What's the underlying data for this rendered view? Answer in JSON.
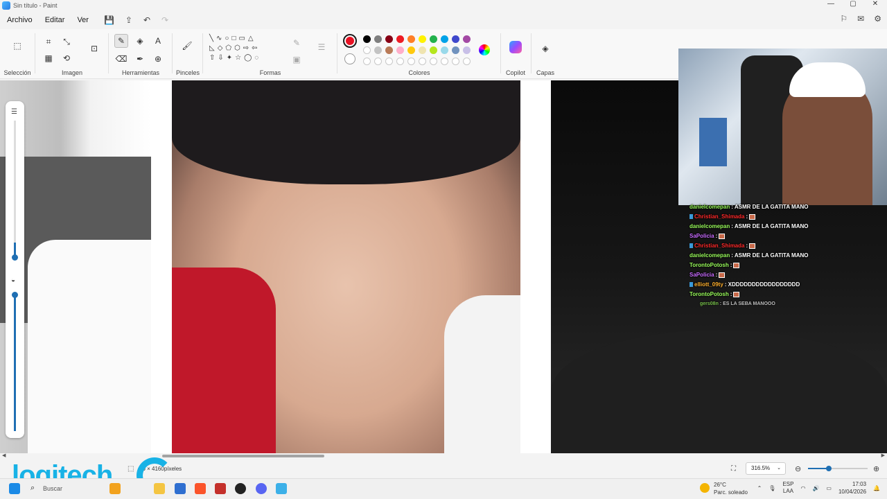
{
  "window": {
    "title": "Sin título - Paint"
  },
  "menu": {
    "archivo": "Archivo",
    "editar": "Editar",
    "ver": "Ver"
  },
  "ribbon": {
    "groups": {
      "seleccion": "Selección",
      "imagen": "Imagen",
      "herramientas": "Herramientas",
      "pinceles": "Pinceles",
      "formas": "Formas",
      "colores": "Colores",
      "copilot": "Copilot",
      "capas": "Capas"
    }
  },
  "colors": {
    "primary": "#e81123",
    "palette_row1": [
      "#000000",
      "#7f7f7f",
      "#880015",
      "#ed1c24",
      "#ff7f27",
      "#fff200",
      "#22b14c",
      "#00a2e8",
      "#3f48cc",
      "#a349a4"
    ],
    "palette_row2": [
      "#ffffff",
      "#c3c3c3",
      "#b97a57",
      "#ffaec9",
      "#ffc90e",
      "#efe4b0",
      "#b5e61d",
      "#99d9ea",
      "#7092be",
      "#c8bfe7"
    ]
  },
  "chat": {
    "messages": [
      {
        "user": "danielcomepan",
        "color": "#9bff5c",
        "text": ": ASMR DE LA GATITA MANO",
        "emote": false,
        "badges": false
      },
      {
        "user": "Christian_Shimada",
        "color": "#ff2a2a",
        "text": ":",
        "emote": true,
        "badges": true
      },
      {
        "user": "danielcomepan",
        "color": "#9bff5c",
        "text": ": ASMR DE LA GATITA MANO",
        "emote": false,
        "badges": false
      },
      {
        "user": "SaPolicia",
        "color": "#c86bff",
        "text": ":",
        "emote": true,
        "badges": false
      },
      {
        "user": "Christian_Shimada",
        "color": "#ff2a2a",
        "text": ":",
        "emote": true,
        "badges": true
      },
      {
        "user": "danielcomepan",
        "color": "#9bff5c",
        "text": ": ASMR DE LA GATITA MANO",
        "emote": false,
        "badges": false
      },
      {
        "user": "TorontoPotosh",
        "color": "#9bff5c",
        "text": ":",
        "emote": true,
        "badges": false
      },
      {
        "user": "SaPolicia",
        "color": "#c86bff",
        "text": ":",
        "emote": true,
        "badges": false
      },
      {
        "user": "elliott_09ty",
        "color": "#ffb02e",
        "text": ": XDDDDDDDDDDDDDDDDD",
        "emote": false,
        "badges": true
      },
      {
        "user": "TorontoPotosh",
        "color": "#9bff5c",
        "text": ":",
        "emote": true,
        "badges": false
      }
    ],
    "faded": {
      "user": "gers08n",
      "text": ": ES LA SEBA MANOOO"
    }
  },
  "statusbar": {
    "dimensions": "20 × 4160píxeles",
    "zoom": "316.5%"
  },
  "logo": {
    "text": "logitech"
  },
  "taskbar": {
    "search_placeholder": "Buscar",
    "temperature": "26°C",
    "weather": "Parc. soleado",
    "lang1": "ESP",
    "lang2": "LAA",
    "time": "17:03",
    "date": "10/04/2026"
  }
}
